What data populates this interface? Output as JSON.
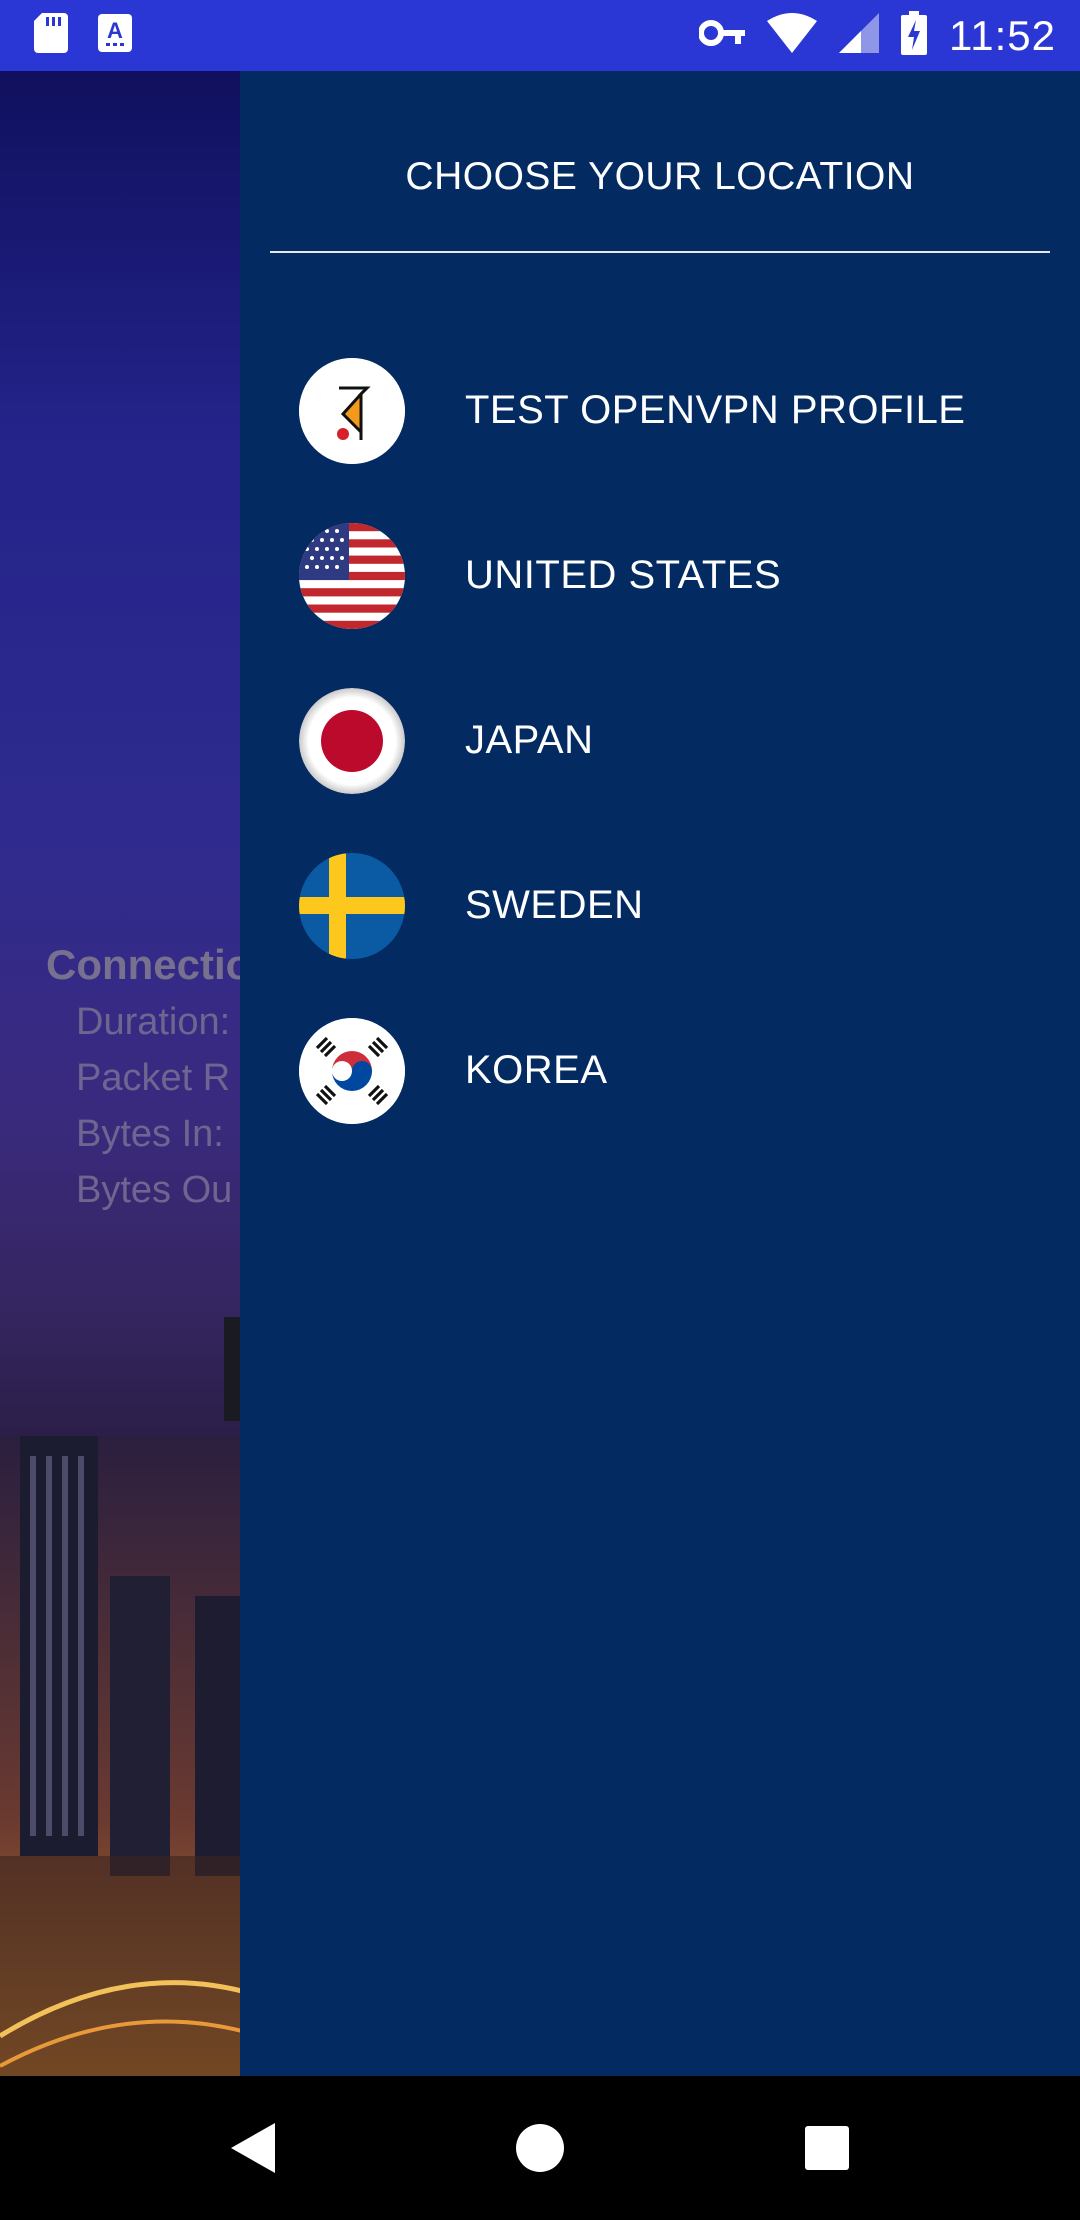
{
  "status_bar": {
    "time": "11:52",
    "left_icons": [
      "sd-card-icon",
      "keyboard-a-icon"
    ],
    "right_icons": [
      "vpn-key-icon",
      "wifi-icon",
      "cell-signal-icon",
      "battery-charging-icon"
    ]
  },
  "background_app": {
    "connection_title": "Connectio",
    "rows": [
      "Duration:",
      "Packet R",
      "Bytes In:",
      "Bytes Ou"
    ]
  },
  "drawer": {
    "title": "CHOOSE YOUR LOCATION",
    "locations": [
      {
        "label": "TEST OPENVPN PROFILE",
        "icon": "openvpn-logo-icon"
      },
      {
        "label": "UNITED STATES",
        "icon": "us-flag-icon"
      },
      {
        "label": "JAPAN",
        "icon": "japan-flag-icon"
      },
      {
        "label": "SWEDEN",
        "icon": "sweden-flag-icon"
      },
      {
        "label": "KOREA",
        "icon": "korea-flag-icon"
      }
    ]
  },
  "nav_bar": {
    "buttons": [
      "back-icon",
      "home-icon",
      "recents-icon"
    ]
  },
  "colors": {
    "status_bar": "#2b37d4",
    "drawer_bg": "#032b62",
    "text": "#ffffff"
  }
}
